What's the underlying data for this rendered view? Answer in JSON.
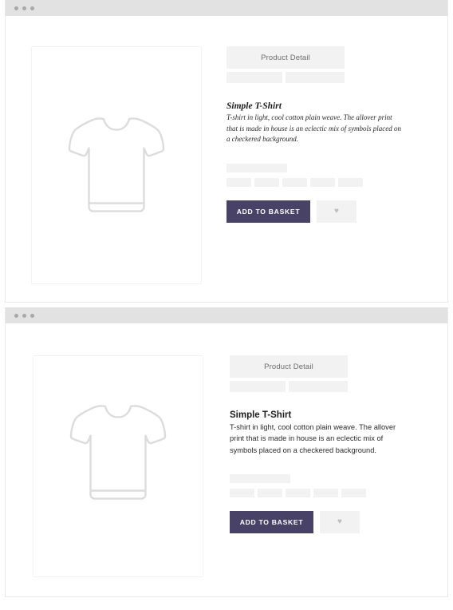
{
  "page": {
    "background": "#ffffff",
    "windows": [
      {
        "id": "window-serif",
        "titlebar": {
          "dots": [
            "dot-1",
            "dot-2",
            "dot-3"
          ],
          "color": "#e2e2e2"
        },
        "product_image": {
          "icon": "tshirt-icon",
          "alt": "Simple T-Shirt product illustration"
        },
        "tabs": {
          "active_label": "Product Detail",
          "placeholder_tabs": [
            "",
            ""
          ]
        },
        "product": {
          "title": "Simple T-Shirt",
          "description": "T-shirt in light, cool cotton plain weave. The allover print that is made in house is an eclectic mix of symbols placed on a checkered background."
        },
        "options": {
          "label_placeholder": "",
          "swatch_placeholders": [
            "",
            "",
            "",
            "",
            ""
          ]
        },
        "actions": {
          "add_to_basket_label": "ADD TO BASKET",
          "add_to_basket_color": "#474266",
          "wishlist_icon": "heart-icon",
          "wishlist_glyph": "♥"
        }
      },
      {
        "id": "window-sans",
        "titlebar": {
          "dots": [
            "dot-1",
            "dot-2",
            "dot-3"
          ],
          "color": "#e2e2e2"
        },
        "product_image": {
          "icon": "tshirt-icon",
          "alt": "Simple T-Shirt product illustration"
        },
        "tabs": {
          "active_label": "Product Detail",
          "placeholder_tabs": [
            "",
            ""
          ]
        },
        "product": {
          "title": "Simple T-Shirt",
          "description": "T-shirt in light, cool cotton plain weave. The allover print that is made in house is an eclectic mix of symbols placed on a checkered background."
        },
        "options": {
          "label_placeholder": "",
          "swatch_placeholders": [
            "",
            "",
            "",
            "",
            ""
          ]
        },
        "actions": {
          "add_to_basket_label": "ADD TO BASKET",
          "add_to_basket_color": "#474266",
          "wishlist_icon": "heart-icon",
          "wishlist_glyph": "♥"
        }
      }
    ]
  }
}
